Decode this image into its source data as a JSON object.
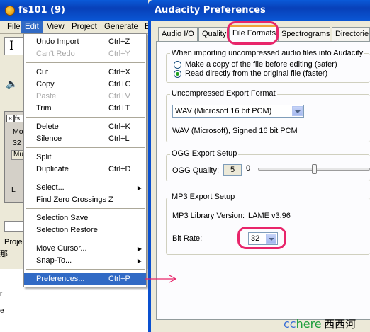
{
  "main_window": {
    "title": "fs101 (9)",
    "menus": [
      "File",
      "Edit",
      "View",
      "Project",
      "Generate",
      "E"
    ],
    "active_menu": "Edit",
    "track": {
      "name": "fs",
      "lines": [
        "Mo",
        "32",
        "Mu"
      ],
      "pan_left": "L",
      "project_label": "Proje"
    }
  },
  "edit_menu": {
    "items": [
      {
        "label": "Undo Import",
        "shortcut": "Ctrl+Z",
        "disabled": false
      },
      {
        "label": "Can't Redo",
        "shortcut": "Ctrl+Y",
        "disabled": true
      },
      {
        "label": "Cut",
        "shortcut": "Ctrl+X",
        "disabled": false
      },
      {
        "label": "Copy",
        "shortcut": "Ctrl+C",
        "disabled": false
      },
      {
        "label": "Paste",
        "shortcut": "Ctrl+V",
        "disabled": true
      },
      {
        "label": "Trim",
        "shortcut": "Ctrl+T",
        "disabled": false
      },
      {
        "label": "Delete",
        "shortcut": "Ctrl+K",
        "disabled": false
      },
      {
        "label": "Silence",
        "shortcut": "Ctrl+L",
        "disabled": false
      },
      {
        "label": "Split",
        "shortcut": "",
        "disabled": false
      },
      {
        "label": "Duplicate",
        "shortcut": "Ctrl+D",
        "disabled": false
      },
      {
        "label": "Select...",
        "shortcut": "",
        "disabled": false,
        "submenu": true
      },
      {
        "label": "Find Zero Crossings",
        "shortcut": "Z",
        "disabled": false
      },
      {
        "label": "Selection Save",
        "shortcut": "",
        "disabled": false
      },
      {
        "label": "Selection Restore",
        "shortcut": "",
        "disabled": false
      },
      {
        "label": "Move Cursor...",
        "shortcut": "",
        "disabled": false,
        "submenu": true
      },
      {
        "label": "Snap-To...",
        "shortcut": "",
        "disabled": false,
        "submenu": true
      },
      {
        "label": "Preferences...",
        "shortcut": "Ctrl+P",
        "disabled": false,
        "highlighted": true
      }
    ]
  },
  "preferences": {
    "title": "Audacity Preferences",
    "tabs": [
      "Audio I/O",
      "Quality",
      "File Formats",
      "Spectrograms",
      "Directories"
    ],
    "selected_tab": "File Formats",
    "import": {
      "heading": "When importing uncompressed audio files into Audacity",
      "option_copy": "Make a copy of the file before editing (safer)",
      "option_direct": "Read directly from the original file (faster)",
      "selected": "direct"
    },
    "uncompressed": {
      "heading": "Uncompressed Export Format",
      "format": "WAV (Microsoft 16 bit PCM)",
      "description": "WAV (Microsoft), Signed 16 bit PCM"
    },
    "ogg": {
      "heading": "OGG Export Setup",
      "quality_label": "OGG Quality:",
      "quality_value": "5",
      "slider_min": "0",
      "slider_level": 0.5
    },
    "mp3": {
      "heading": "MP3 Export Setup",
      "library_label": "MP3 Library Version:",
      "library_value": "LAME v3.96",
      "bitrate_label": "Bit Rate:",
      "bitrate_value": "32"
    }
  },
  "decor": {
    "side_chars": [
      "那",
      "r",
      "e"
    ],
    "misc_char": "T"
  },
  "watermark": {
    "cc": "cc",
    "here": "here",
    "cn": "西西河"
  },
  "colors": {
    "highlight_ring": "#e8256a",
    "titlebar": "#0a56d4",
    "menu_highlight": "#316ac5"
  }
}
